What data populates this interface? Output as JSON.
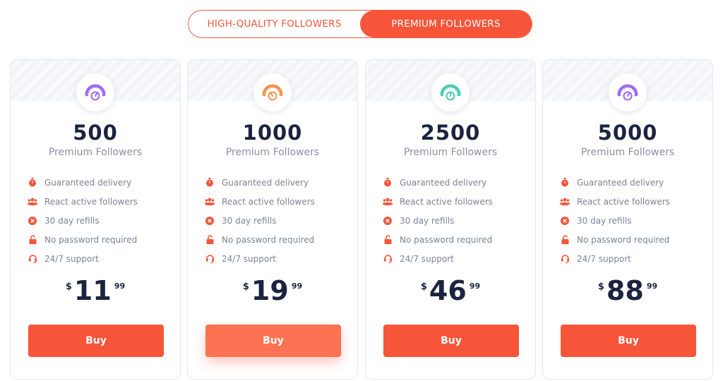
{
  "toggle": {
    "option_hq": "HIGH-QUALITY FOLLOWERS",
    "option_premium": "PREMIUM FOLLOWERS",
    "active": "premium"
  },
  "colors": {
    "accent": "#f6553a",
    "accent_light": "#fd7252",
    "text_dark": "#1c2340",
    "text_muted": "#8a8fa5"
  },
  "plans": [
    {
      "amount": "500",
      "label": "Premium Followers",
      "badge_icon": "gauge-purple-icon",
      "badge_color": "#9b6cf0",
      "features": [
        "Guaranteed delivery",
        "React active followers",
        "30 day refills",
        "No password required",
        "24/7 support"
      ],
      "currency": "$",
      "price_int": "11",
      "price_cents": "99",
      "buy_label": "Buy"
    },
    {
      "amount": "1000",
      "label": "Premium Followers",
      "badge_icon": "gauge-orange-icon",
      "badge_color": "#f4934c",
      "features": [
        "Guaranteed delivery",
        "React active followers",
        "30 day refills",
        "No password required",
        "24/7 support"
      ],
      "currency": "$",
      "price_int": "19",
      "price_cents": "99",
      "buy_label": "Buy"
    },
    {
      "amount": "2500",
      "label": "Premium Followers",
      "badge_icon": "gauge-teal-icon",
      "badge_color": "#48cfb0",
      "features": [
        "Guaranteed delivery",
        "React active followers",
        "30 day refills",
        "No password required",
        "24/7 support"
      ],
      "currency": "$",
      "price_int": "46",
      "price_cents": "99",
      "buy_label": "Buy"
    },
    {
      "amount": "5000",
      "label": "Premium Followers",
      "badge_icon": "gauge-purple-icon",
      "badge_color": "#9b6cf0",
      "features": [
        "Guaranteed delivery",
        "React active followers",
        "30 day refills",
        "No password required",
        "24/7 support"
      ],
      "currency": "$",
      "price_int": "88",
      "price_cents": "99",
      "buy_label": "Buy"
    }
  ],
  "feature_icons": [
    "stopwatch-icon",
    "users-icon",
    "x-circle-icon",
    "unlock-icon",
    "headset-icon"
  ]
}
